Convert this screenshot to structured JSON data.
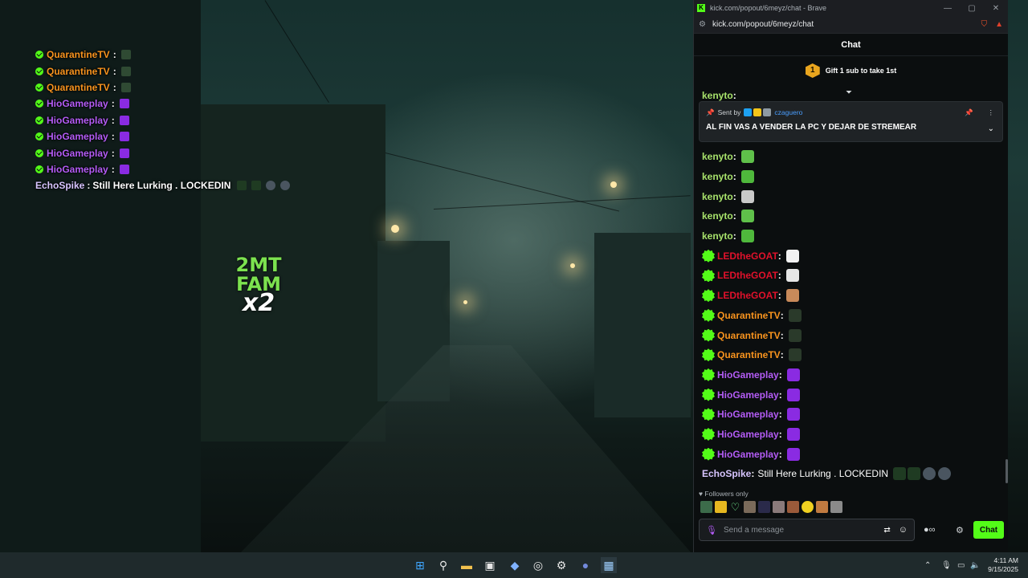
{
  "overlay": {
    "rows": [
      {
        "user": "QuarantineTV",
        "color": "#f7931e",
        "sep": ":",
        "emote": "vibe-check-emote"
      },
      {
        "user": "QuarantineTV",
        "color": "#f7931e",
        "sep": ":",
        "emote": "vibe-check-emote"
      },
      {
        "user": "QuarantineTV",
        "color": "#f7931e",
        "sep": ":",
        "emote": "vibe-check-emote"
      },
      {
        "user": "HioGameplay",
        "color": "#b45cf6",
        "sep": ":",
        "emote": "purple-emote"
      },
      {
        "user": "HioGameplay",
        "color": "#b45cf6",
        "sep": ":",
        "emote": "purple-emote"
      },
      {
        "user": "HioGameplay",
        "color": "#b45cf6",
        "sep": ":",
        "emote": "purple-emote"
      },
      {
        "user": "HioGameplay",
        "color": "#b45cf6",
        "sep": ":",
        "emote": "purple-emote"
      },
      {
        "user": "HioGameplay",
        "color": "#b45cf6",
        "sep": ":",
        "emote": "purple-emote"
      }
    ],
    "echo": {
      "user": "EchoSpike",
      "color": "#d8c5ff",
      "text": "Still Here Lurking . LOCKEDIN"
    },
    "big_emote": {
      "line1": "2MT",
      "line2": "FAM",
      "line3": "x2"
    }
  },
  "browser": {
    "title": "kick.com/popout/6meyz/chat - Brave",
    "url": "kick.com/popout/6meyz/chat"
  },
  "chat": {
    "header": "Chat",
    "gift": {
      "badge": "1",
      "text": "Gift 1 sub to take 1st"
    },
    "pinned": {
      "sent_by_label": "Sent by",
      "sender": "czaguero",
      "message": "AL FIN VAS A VENDER LA PC Y DEJAR DE STREMEAR"
    },
    "partial_top_user": "kenyto",
    "messages": [
      {
        "user": "kenyto",
        "color": "#a8e26b",
        "verified": false,
        "emote_color": "#5fc04a"
      },
      {
        "user": "kenyto",
        "color": "#a8e26b",
        "verified": false,
        "emote_color": "#4fb83c"
      },
      {
        "user": "kenyto",
        "color": "#a8e26b",
        "verified": false,
        "emote_color": "#c9c9c9"
      },
      {
        "user": "kenyto",
        "color": "#a8e26b",
        "verified": false,
        "emote_color": "#5fc04a"
      },
      {
        "user": "kenyto",
        "color": "#a8e26b",
        "verified": false,
        "emote_color": "#4fb83c"
      },
      {
        "user": "LEDtheGOAT",
        "color": "#e0112b",
        "verified": true,
        "emote_color": "#f2f2f2"
      },
      {
        "user": "LEDtheGOAT",
        "color": "#e0112b",
        "verified": true,
        "emote_color": "#e6e6e6"
      },
      {
        "user": "LEDtheGOAT",
        "color": "#e0112b",
        "verified": true,
        "emote_color": "#c88a5a"
      },
      {
        "user": "QuarantineTV",
        "color": "#f7931e",
        "verified": true,
        "emote_color": "#2a3a2a"
      },
      {
        "user": "QuarantineTV",
        "color": "#f7931e",
        "verified": true,
        "emote_color": "#2a3a2a"
      },
      {
        "user": "QuarantineTV",
        "color": "#f7931e",
        "verified": true,
        "emote_color": "#2a3a2a"
      },
      {
        "user": "HioGameplay",
        "color": "#b45cf6",
        "verified": true,
        "emote_color": "#8a2be2"
      },
      {
        "user": "HioGameplay",
        "color": "#b45cf6",
        "verified": true,
        "emote_color": "#8a2be2"
      },
      {
        "user": "HioGameplay",
        "color": "#b45cf6",
        "verified": true,
        "emote_color": "#8a2be2"
      },
      {
        "user": "HioGameplay",
        "color": "#b45cf6",
        "verified": true,
        "emote_color": "#8a2be2"
      },
      {
        "user": "HioGameplay",
        "color": "#b45cf6",
        "verified": true,
        "emote_color": "#8a2be2"
      }
    ],
    "echo": {
      "user": "EchoSpike",
      "color": "#d8c5ff",
      "text": "Still Here Lurking . LOCKEDIN"
    },
    "followers_label": "Followers only",
    "input_placeholder": "Send a message",
    "send_label": "Chat"
  },
  "taskbar": {
    "time": "4:11 AM",
    "date": "9/15/2025"
  },
  "colors": {
    "kick_green": "#53fc18",
    "chat_bg": "#0b0e0f"
  }
}
